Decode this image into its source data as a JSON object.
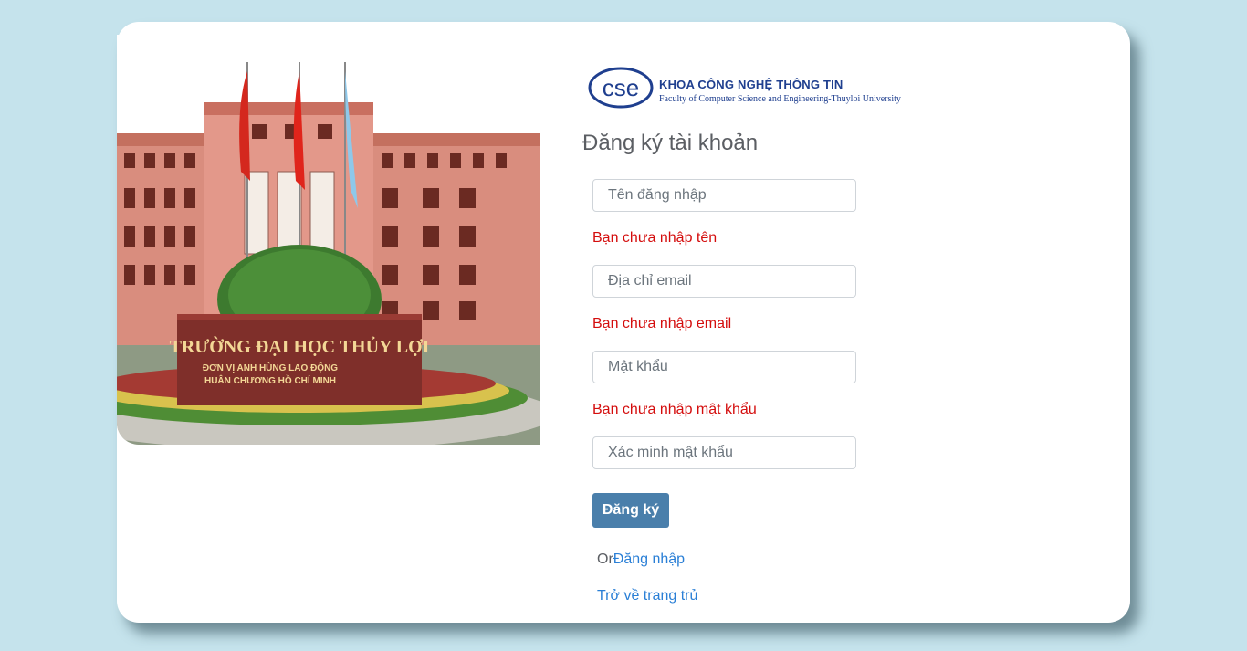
{
  "colors": {
    "background": "#c5e3ec",
    "card": "#ffffff",
    "error": "#d40d0d",
    "button": "#4a7fab",
    "link": "#2a7fd6",
    "logo": "#1f3f8f"
  },
  "campus_photo": {
    "sign_line1": "TRƯỜNG ĐẠI HỌC THỦY LỢI",
    "sign_line2": "ĐƠN VỊ ANH HÙNG LAO ĐỘNG",
    "sign_line3": "HUÂN CHƯƠNG HỒ CHÍ MINH"
  },
  "logo": {
    "mark": "cse",
    "title": "KHOA CÔNG NGHỆ THÔNG TIN",
    "subtitle": "Faculty of Computer Science and Engineering-Thuyloi University"
  },
  "form": {
    "title": "Đăng ký tài khoản",
    "username": {
      "placeholder": "Tên đăng nhập",
      "value": "",
      "error": "Bạn chưa nhập tên"
    },
    "email": {
      "placeholder": "Địa chỉ email",
      "value": "",
      "error": "Bạn chưa nhập email"
    },
    "password": {
      "placeholder": "Mật khẩu",
      "value": "",
      "error": "Bạn chưa nhập mật khẩu"
    },
    "confirm_password": {
      "placeholder": "Xác minh mật khẩu",
      "value": ""
    },
    "submit_label": "Đăng ký",
    "or_text": "Or",
    "login_link": "Đăng nhập",
    "home_link": "Trở về trang trủ"
  }
}
